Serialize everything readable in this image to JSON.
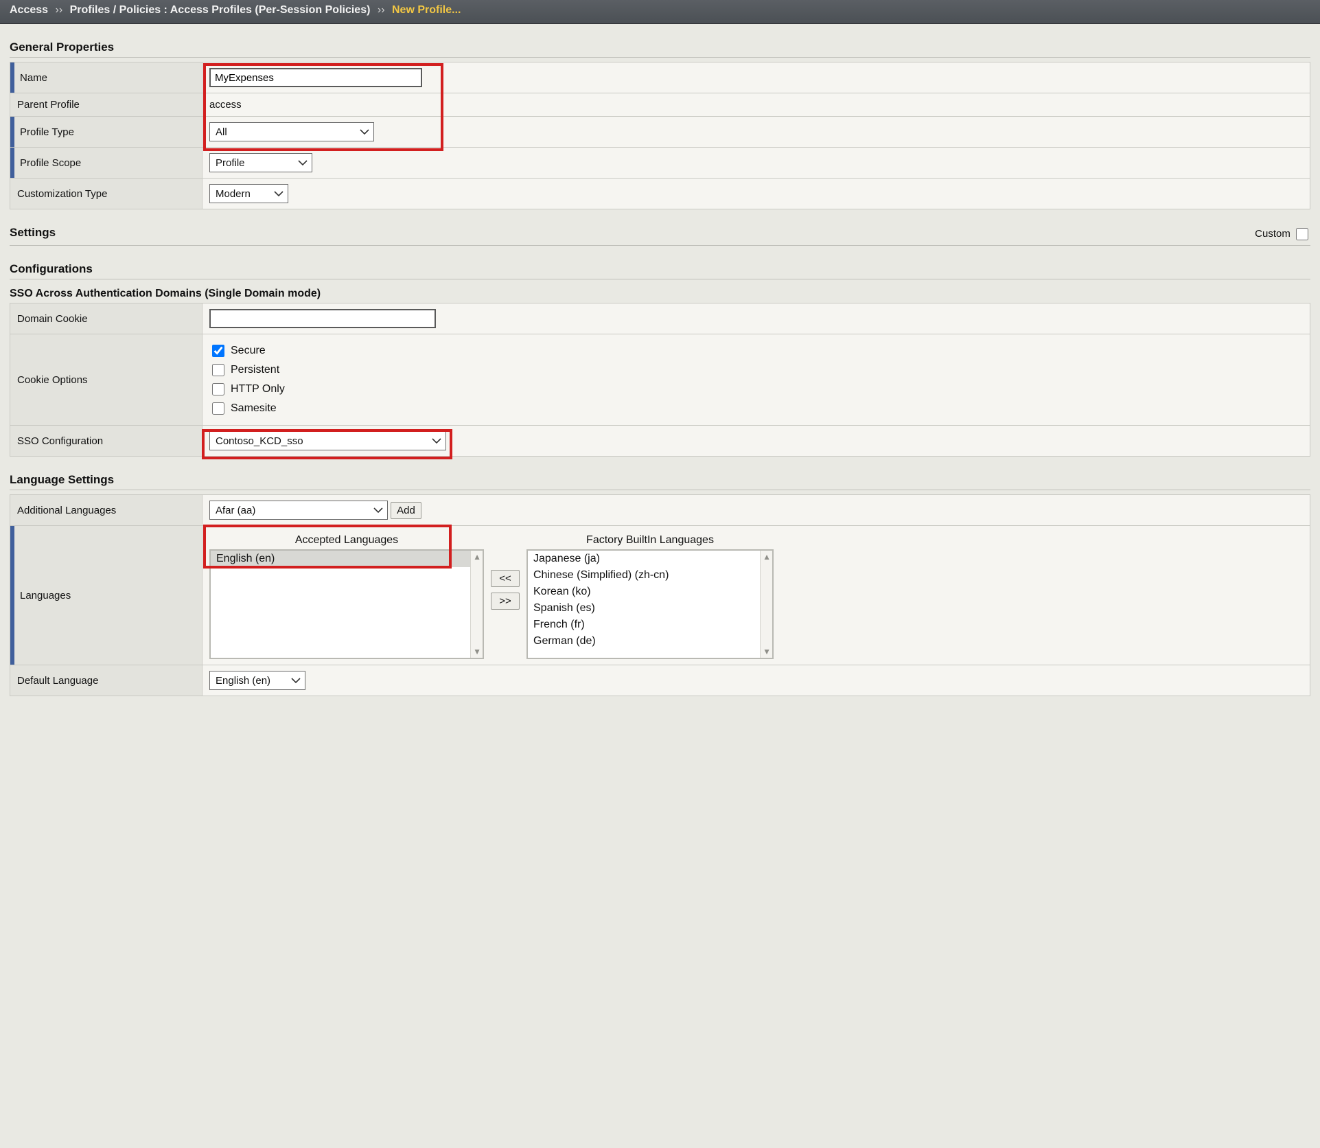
{
  "breadcrumb": {
    "root": "Access",
    "sep1": "››",
    "mid": "Profiles / Policies : Access Profiles (Per-Session Policies)",
    "sep2": "››",
    "current": "New Profile..."
  },
  "sections": {
    "general": "General Properties",
    "settings": "Settings",
    "custom_label": "Custom",
    "configurations": "Configurations",
    "sso_header": "SSO Across Authentication Domains (Single Domain mode)",
    "language": "Language Settings"
  },
  "general": {
    "name_label": "Name",
    "name_value": "MyExpenses",
    "parent_label": "Parent Profile",
    "parent_value": "access",
    "profile_type_label": "Profile Type",
    "profile_type_value": "All",
    "profile_scope_label": "Profile Scope",
    "profile_scope_value": "Profile",
    "custom_type_label": "Customization Type",
    "custom_type_value": "Modern"
  },
  "sso": {
    "domain_cookie_label": "Domain Cookie",
    "domain_cookie_value": "",
    "cookie_options_label": "Cookie Options",
    "opts": {
      "secure": "Secure",
      "persistent": "Persistent",
      "http_only": "HTTP Only",
      "samesite": "Samesite"
    },
    "opts_checked": {
      "secure": true,
      "persistent": false,
      "http_only": false,
      "samesite": false
    },
    "sso_config_label": "SSO Configuration",
    "sso_config_value": "Contoso_KCD_sso"
  },
  "lang": {
    "additional_label": "Additional Languages",
    "additional_value": "Afar (aa)",
    "add_btn": "Add",
    "languages_label": "Languages",
    "accepted_title": "Accepted Languages",
    "factory_title": "Factory BuiltIn Languages",
    "accepted_items": [
      "English (en)"
    ],
    "factory_items": [
      "Japanese (ja)",
      "Chinese (Simplified) (zh-cn)",
      "Korean (ko)",
      "Spanish (es)",
      "French (fr)",
      "German (de)"
    ],
    "move_left": "<<",
    "move_right": ">>",
    "default_label": "Default Language",
    "default_value": "English (en)"
  }
}
